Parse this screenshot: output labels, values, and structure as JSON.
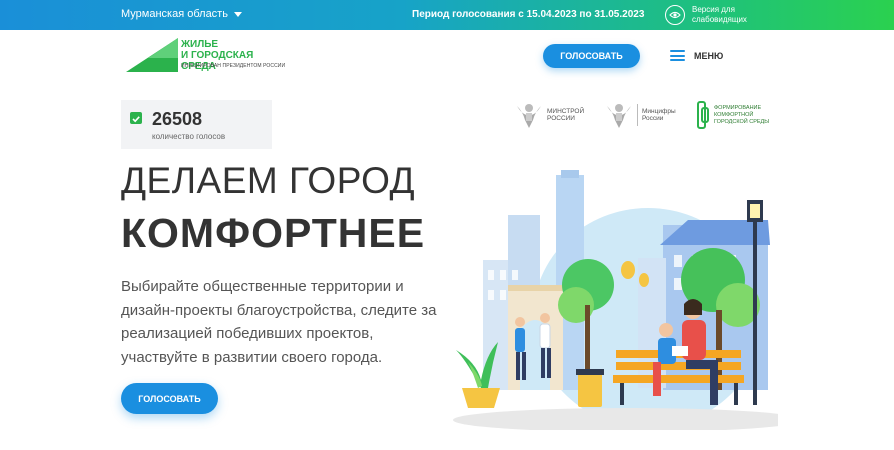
{
  "topbar": {
    "region": "Мурманская область",
    "period": "Период голосования с 15.04.2023 по 31.05.2023",
    "accessibility_line1": "Версия для",
    "accessibility_line2": "слабовидящих"
  },
  "header": {
    "logo_title": "ЖИЛЬЕ\nИ ГОРОДСКАЯ СРЕДА",
    "logo_subtitle": "ИНИЦИИРОВАН ПРЕЗИДЕНТОМ РОССИИ",
    "vote_label": "ГОЛОСОВАТЬ",
    "menu_label": "МЕНЮ"
  },
  "counter": {
    "value": "26508",
    "label": "количество голосов"
  },
  "partners": {
    "minstroy": "МИНСТРОЙ\nРОССИИ",
    "mintsifry": "Минцифры\nРоссии",
    "fks": "ФОРМИРОВАНИЕ\nКОМФОРТНОЙ\nГОРОДСКОЙ СРЕДЫ"
  },
  "hero": {
    "line1": "ДЕЛАЕМ ГОРОД",
    "line2": "КОМФОРТНЕЕ",
    "description": "Выбирайте общественные территории и дизайн-проекты благоустройства, следите за реализацией победивших проектов, участвуйте в развитии своего города.",
    "vote_label": "ГОЛОСОВАТЬ"
  },
  "colors": {
    "accent_blue": "#1a8fe0",
    "brand_green": "#2bb24c",
    "text_dark": "#333333"
  }
}
